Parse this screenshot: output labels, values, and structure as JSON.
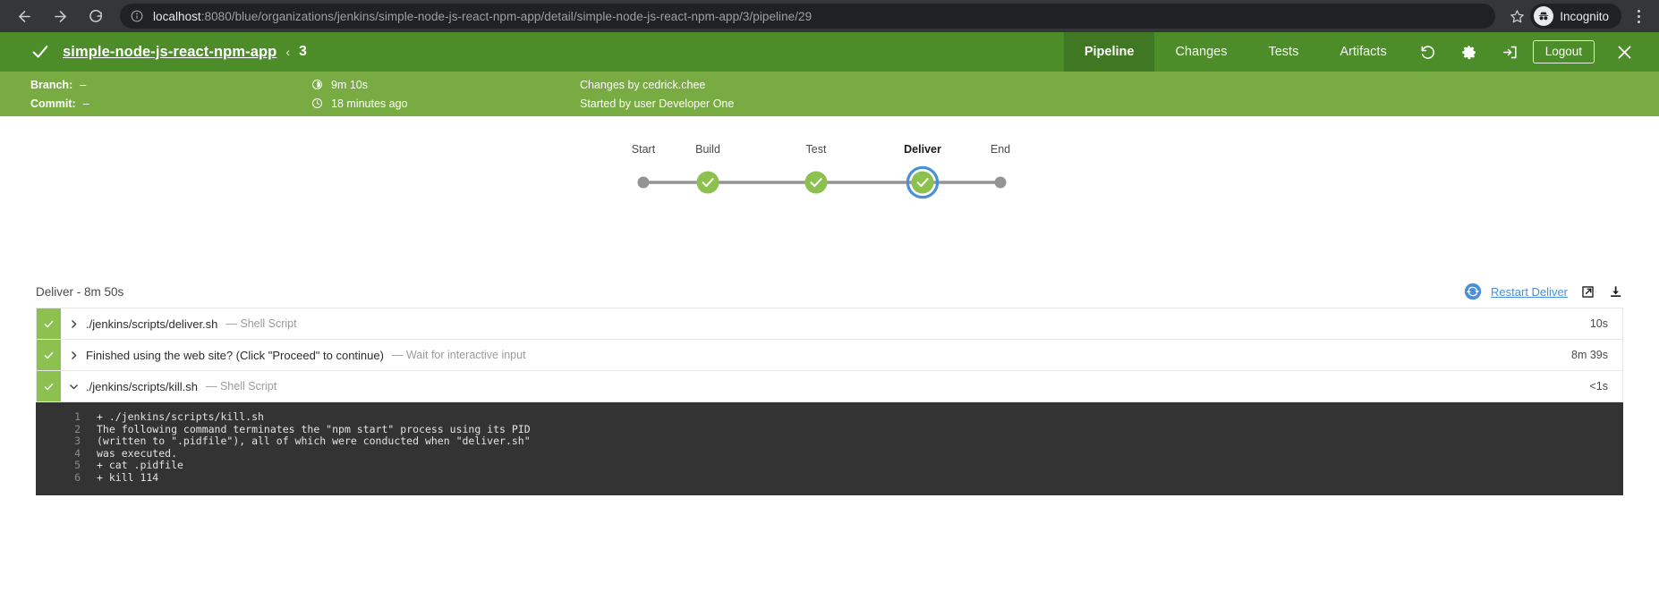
{
  "browser": {
    "url_host": "localhost",
    "url_rest": ":8080/blue/organizations/jenkins/simple-node-js-react-npm-app/detail/simple-node-js-react-npm-app/3/pipeline/29",
    "profile_label": "Incognito",
    "back_icon": "back-arrow-icon",
    "forward_icon": "forward-arrow-icon",
    "reload_icon": "reload-icon",
    "info_icon": "site-info-icon",
    "star_icon": "bookmark-star-icon",
    "menu_icon": "kebab-menu-icon"
  },
  "header": {
    "status_icon": "success-check-icon",
    "pipeline_name": "simple-node-js-react-npm-app",
    "separator": "‹",
    "run_number": "3",
    "accent_green": "#4c8d29",
    "meta_green": "#78ab41",
    "tabs": [
      {
        "label": "Pipeline",
        "active": true
      },
      {
        "label": "Changes",
        "active": false
      },
      {
        "label": "Tests",
        "active": false
      },
      {
        "label": "Artifacts",
        "active": false
      }
    ],
    "actions": {
      "replay_icon": "replay-icon",
      "settings_icon": "gear-icon",
      "logout_arrow_icon": "logout-arrow-icon",
      "logout_label": "Logout",
      "close_icon": "close-icon"
    }
  },
  "meta": {
    "branch_label": "Branch:",
    "branch_value": "–",
    "commit_label": "Commit:",
    "commit_value": "–",
    "duration_icon": "duration-clock-icon",
    "duration_value": "9m 10s",
    "time_icon": "time-clock-icon",
    "time_value": "18 minutes ago",
    "changes_by": "Changes by cedrick.chee",
    "started_by": "Started by user Developer One"
  },
  "graph": {
    "stages": [
      {
        "label": "Start",
        "type": "terminal",
        "state": "inactive",
        "selected": false
      },
      {
        "label": "Build",
        "type": "stage",
        "state": "success",
        "selected": false
      },
      {
        "label": "Test",
        "type": "stage",
        "state": "success",
        "selected": false
      },
      {
        "label": "Deliver",
        "type": "stage",
        "state": "success",
        "selected": true
      },
      {
        "label": "End",
        "type": "terminal",
        "state": "inactive",
        "selected": false
      }
    ],
    "success_color": "#8cc04f",
    "selection_color": "#4a90d9",
    "inactive_color": "#949494"
  },
  "log": {
    "title": "Deliver - 8m 50s",
    "restart_icon": "restart-circular-icon",
    "restart_label": "Restart Deliver",
    "open_external_icon": "open-external-icon",
    "download_icon": "download-icon",
    "steps": [
      {
        "status_icon": "success-check-icon",
        "chevron": "chevron-right-icon",
        "expanded": false,
        "name": "./jenkins/scripts/deliver.sh",
        "type": "— Shell Script",
        "duration": "10s"
      },
      {
        "status_icon": "success-check-icon",
        "chevron": "chevron-right-icon",
        "expanded": false,
        "name": "Finished using the web site? (Click \"Proceed\" to continue)",
        "type": "— Wait for interactive input",
        "duration": "8m 39s"
      },
      {
        "status_icon": "success-check-icon",
        "chevron": "chevron-down-icon",
        "expanded": true,
        "name": "./jenkins/scripts/kill.sh",
        "type": "— Shell Script",
        "duration": "<1s"
      }
    ],
    "console_lines": [
      {
        "n": "1",
        "text": "+ ./jenkins/scripts/kill.sh"
      },
      {
        "n": "2",
        "text": "The following command terminates the \"npm start\" process using its PID"
      },
      {
        "n": "3",
        "text": "(written to \".pidfile\"), all of which were conducted when \"deliver.sh\""
      },
      {
        "n": "4",
        "text": "was executed."
      },
      {
        "n": "5",
        "text": "+ cat .pidfile"
      },
      {
        "n": "6",
        "text": "+ kill 114"
      }
    ]
  }
}
